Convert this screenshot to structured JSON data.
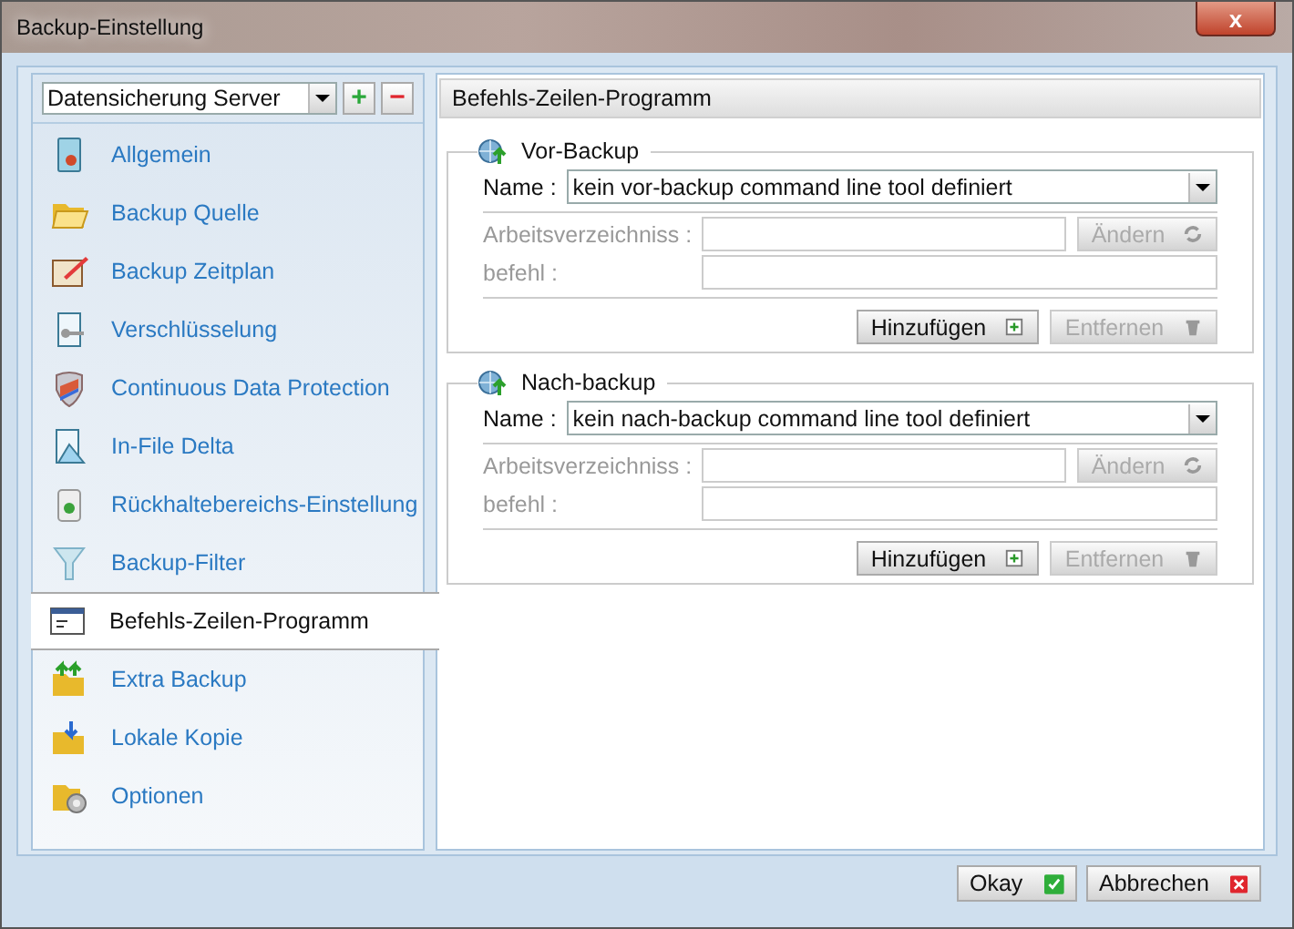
{
  "window": {
    "title": "Backup-Einstellung",
    "close": "x"
  },
  "profile": {
    "value": "Datensicherung Server",
    "add": "+",
    "remove": "−"
  },
  "sidebar": {
    "items": [
      {
        "label": "Allgemein",
        "selected": false
      },
      {
        "label": "Backup Quelle",
        "selected": false
      },
      {
        "label": "Backup Zeitplan",
        "selected": false
      },
      {
        "label": "Verschlüsselung",
        "selected": false
      },
      {
        "label": "Continuous Data Protection",
        "selected": false
      },
      {
        "label": "In-File Delta",
        "selected": false
      },
      {
        "label": "Rückhaltebereichs-Einstellung",
        "selected": false
      },
      {
        "label": "Backup-Filter",
        "selected": false
      },
      {
        "label": "Befehls-Zeilen-Programm",
        "selected": true
      },
      {
        "label": "Extra Backup",
        "selected": false
      },
      {
        "label": "Lokale Kopie",
        "selected": false
      },
      {
        "label": "Optionen",
        "selected": false
      }
    ]
  },
  "panel": {
    "title": "Befehls-Zeilen-Programm"
  },
  "sections": [
    {
      "title": "Vor-Backup",
      "name_label": "Name :",
      "name_value": "kein vor-backup command line tool definiert",
      "workdir_label": "Arbeitsverzeichniss :",
      "command_label": "befehl :",
      "fields_disabled": true,
      "change_button": {
        "label": "Ändern",
        "disabled": true
      },
      "add_button": {
        "label": "Hinzufügen",
        "disabled": false
      },
      "remove_button": {
        "label": "Entfernen",
        "disabled": true
      }
    },
    {
      "title": "Nach-backup",
      "name_label": "Name :",
      "name_value": "kein nach-backup command line tool definiert",
      "workdir_label": "Arbeitsverzeichniss :",
      "command_label": "befehl :",
      "fields_disabled": true,
      "change_button": {
        "label": "Ändern",
        "disabled": true
      },
      "add_button": {
        "label": "Hinzufügen",
        "disabled": false
      },
      "remove_button": {
        "label": "Entfernen",
        "disabled": true
      }
    }
  ],
  "footer": {
    "ok": "Okay",
    "cancel": "Abbrechen"
  }
}
